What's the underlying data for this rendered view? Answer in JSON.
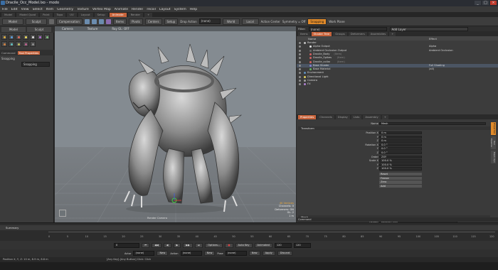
{
  "window": {
    "title": "Dracile_Occ_Model.lxo - modo",
    "minimize": "_",
    "maximize": "□",
    "close": "×"
  },
  "menu": [
    "File",
    "Edit",
    "View",
    "Select",
    "Item",
    "Geometry",
    "Texture",
    "Vertex Map",
    "Animate",
    "Render",
    "recoil",
    "Layout",
    "System",
    "Help"
  ],
  "mode_tabs": [
    {
      "label": "Model",
      "active": false
    },
    {
      "label": "Model Quad",
      "active": false
    },
    {
      "label": "Paint",
      "active": false
    },
    {
      "label": "Topo",
      "active": false
    },
    {
      "label": "UV",
      "active": false
    },
    {
      "label": "Layout",
      "active": false
    },
    {
      "label": "Setup",
      "active": false
    },
    {
      "label": "Animate",
      "active": true
    },
    {
      "label": "Render",
      "active": false
    },
    {
      "label": "+",
      "active": false
    }
  ],
  "toolbar": {
    "model": "Model",
    "sculpt": "Sculpt",
    "compensation": "Compensation",
    "items": "Items",
    "pivots": "Pivots",
    "centers": "Centers",
    "setup": "Setup",
    "drop_action_label": "Drop Action",
    "drop_action_value": "(none)",
    "world": "World",
    "local": "Local",
    "action_center_label": "Action Center",
    "symmetry_label": "Symmetry = Off",
    "snapping": "Snapping",
    "work_plane": "Work Plane"
  },
  "left_panel": {
    "tabs": [
      "Model",
      "Sculpt"
    ],
    "command_tabs": [
      "Command",
      "Tool Properties"
    ],
    "snapping_label": "Snapping",
    "snapping_value": "Snapping"
  },
  "viewport": {
    "header": [
      "Camera",
      "Texture",
      "Ray GL: OFF"
    ],
    "stats": {
      "vertices": "4K Vertices",
      "channels": "Channels: 0",
      "deformers": "Deformers: ON",
      "gl": "GL: 2",
      "distance": "1 m"
    },
    "render_label": "Render Camera"
  },
  "shader_panel": {
    "filter_label": "Filter:",
    "filter_value": "(none)",
    "add_layer": "Add Layer",
    "tabs": [
      {
        "label": "Items",
        "active": false
      },
      {
        "label": "Shader Tree",
        "active": true
      },
      {
        "label": "Groups",
        "active": false
      },
      {
        "label": "Deformers",
        "active": false
      },
      {
        "label": "Assemblies",
        "active": false
      },
      {
        "label": "+",
        "active": false
      }
    ],
    "columns": {
      "name": "Name",
      "effect": "Effect"
    },
    "rows": [
      {
        "name": "Render",
        "effect": "",
        "indent": 0
      },
      {
        "name": "Alpha Output",
        "effect": "Alpha",
        "indent": 1
      },
      {
        "name": "Ambient Occlusion Output",
        "effect": "Ambient Occlusion",
        "indent": 1
      },
      {
        "name": "Dracile_Body",
        "tag": "(Item)",
        "effect": "",
        "indent": 1
      },
      {
        "name": "Dracile_Spikes",
        "tag": "(Item)",
        "effect": "",
        "indent": 1
      },
      {
        "name": "Dracile_collar",
        "tag": "(Item)",
        "effect": "",
        "indent": 1
      },
      {
        "name": "Base Shader",
        "effect": "Full Shading",
        "indent": 1
      },
      {
        "name": "Base Material",
        "effect": "(all)",
        "indent": 1
      },
      {
        "name": "Environment",
        "effect": "",
        "indent": 0
      },
      {
        "name": "Directional Light",
        "effect": "",
        "indent": 0
      },
      {
        "name": "Camera",
        "effect": "",
        "indent": 0
      },
      {
        "name": "FX",
        "effect": "",
        "indent": 0
      }
    ]
  },
  "props_panel": {
    "tabs": [
      {
        "label": "Properties",
        "active": true
      },
      {
        "label": "Channels",
        "active": false
      },
      {
        "label": "Display",
        "active": false
      },
      {
        "label": "Lists",
        "active": false
      },
      {
        "label": "Assembly",
        "active": false
      },
      {
        "label": "+",
        "active": false
      }
    ],
    "name_label": "Name",
    "name_value": "Mesh",
    "transform_section": "Transform",
    "fields": [
      {
        "label": "Position X",
        "value": "0 m"
      },
      {
        "label": "Y",
        "value": "0 m"
      },
      {
        "label": "Z",
        "value": "0 m"
      },
      {
        "label": "Rotation X",
        "value": "0.0 °"
      },
      {
        "label": "Y",
        "value": "0.0 °"
      },
      {
        "label": "Z",
        "value": "0.0 °"
      },
      {
        "label": "Order",
        "value": "ZXY"
      },
      {
        "label": "Scale X",
        "value": "100.0 %"
      },
      {
        "label": "Y",
        "value": "100.0 %"
      },
      {
        "label": "Z",
        "value": "100.0 %"
      }
    ],
    "buttons": [
      "Reset",
      "Freeze",
      "Zero",
      "Add"
    ],
    "mesh_section": "Mesh",
    "render_label": "Render",
    "render_value": "Default (Yes)",
    "dissolve_label": "Dissolve",
    "dissolve_value": "0.0 %",
    "side_tabs": [
      "Properties",
      "Tool Pipeline",
      "Mesh Ops"
    ]
  },
  "command_line": {
    "label": "Command"
  },
  "timeline": {
    "track_name": "Summary",
    "ticks": [
      "0",
      "5",
      "10",
      "15",
      "20",
      "25",
      "30",
      "35",
      "40",
      "45",
      "50",
      "55",
      "60",
      "65",
      "70",
      "75",
      "80",
      "85",
      "90",
      "95",
      "100",
      "105",
      "110",
      "115",
      "120"
    ],
    "current_frame": "0",
    "options": "Options...",
    "auto_key": "Auto Key",
    "animated": "Animated",
    "start": "120",
    "end": "120"
  },
  "keybar": {
    "actor_label": "Actor",
    "actor_value": "(none)",
    "new1": "New",
    "action_label": "Action",
    "action_value": "(none)",
    "new2": "New",
    "pose_label": "Pose",
    "pose_value": "(none)",
    "new3": "New",
    "apply": "Apply",
    "discard": "Discard"
  },
  "status": {
    "position": "Position X, Y, Z:   10 m, 8.9 m, 8.8 m",
    "hint": "[Any Key]-[Any Button] Click:   Click"
  },
  "colors": {
    "accent": "#e08a2a",
    "tab_active": "#c8643c",
    "viewport_bg": "#848b91"
  }
}
